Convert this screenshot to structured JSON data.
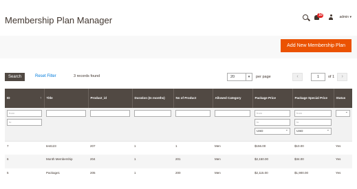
{
  "header": {
    "title": "Membership Plan Manager",
    "notification_count": "10",
    "admin_label": "admin ▾"
  },
  "actions": {
    "add_label": "Add New Membership Plan"
  },
  "toolbar": {
    "search_label": "Search",
    "reset_label": "Reset Filter",
    "records_text": "3 records found",
    "per_page_value": "20",
    "per_page_label": "per page",
    "prev": "‹",
    "page_value": "1",
    "of_text": "of 1",
    "next": "›"
  },
  "grid": {
    "columns": [
      "ID",
      "Title",
      "Product_id",
      "Duration (In months)",
      "No of Product",
      "Allowed Category",
      "Package Price",
      "Package Special Price",
      "Status"
    ],
    "filters": {
      "from_placeholder": "from",
      "to_placeholder": "to",
      "currency": "USD"
    },
    "rows": [
      {
        "id": "7",
        "title": "test123",
        "product_id": "207",
        "duration": "1",
        "no_of_product": "1",
        "category": "Men",
        "price": "$156.00",
        "special_price": "$10.00",
        "status": "Yes"
      },
      {
        "id": "6",
        "title": "Month Membership",
        "product_id": "204",
        "duration": "1",
        "no_of_product": "201",
        "category": "Men",
        "price": "$2,150.00",
        "special_price": "$34.00",
        "status": "Yes"
      },
      {
        "id": "5",
        "title": "Package1",
        "product_id": "205",
        "duration": "1",
        "no_of_product": "200",
        "category": "Men",
        "price": "$2,115.00",
        "special_price": "$1,900.00",
        "status": "Yes"
      }
    ]
  },
  "colors": {
    "accent": "#eb5202",
    "header_dark": "#514943",
    "link": "#007bdb"
  }
}
